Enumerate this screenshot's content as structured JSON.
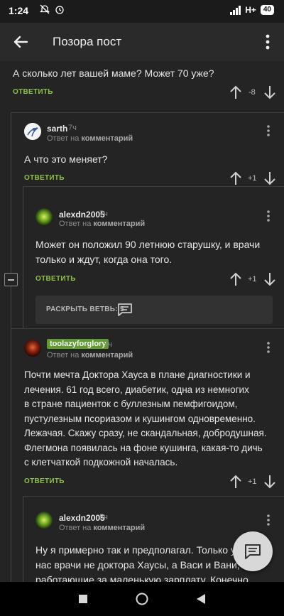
{
  "status_bar": {
    "time": "1:24",
    "icons": [
      "mute-icon",
      "alarm-icon"
    ],
    "network": "H+",
    "battery": "40"
  },
  "app_bar": {
    "title": "Позора пост"
  },
  "comments": [
    {
      "text": "А сколько лет вашей маме? Может 70 уже?",
      "reply_label": "ОТВЕТИТЬ",
      "rating": "-8"
    },
    {
      "username": "sarth",
      "time": "7ч",
      "reply_prefix": "Ответ на",
      "reply_target": "комментарий",
      "text": "А что это меняет?",
      "reply_label": "ОТВЕТИТЬ",
      "rating": "+1"
    },
    {
      "username": "alexdn2005",
      "time": "7ч",
      "reply_prefix": "Ответ на",
      "reply_target": "комментарий",
      "text_lines": [
        "Может он положил 90 летнюю старушку, и врачи",
        "только и ждут, когда она того."
      ],
      "reply_label": "ОТВЕТИТЬ",
      "rating": "+1"
    },
    {
      "username": "toolazyforglory",
      "time": "5ч",
      "reply_prefix": "Ответ на",
      "reply_target": "комментарий",
      "text_lines": [
        "Почти мечта Доктора Хауса в плане диагностики и",
        "лечения. 61 год всего, диабетик, одна из немногих",
        "в стране пациенток с буллезным пемфигоидом,",
        "пустулезным псориазом и кушингом одновременно.",
        "Лежачая. Скажу сразу, не скандальная, добродушная.",
        "Флегмона появилась на фоне кушинга, какая-то дичь",
        "с клетчаткой подкожной началась."
      ],
      "reply_label": "ОТВЕТИТЬ",
      "rating": "+1"
    },
    {
      "username": "alexdn2005",
      "time": "5ч",
      "reply_prefix": "Ответ на",
      "reply_target": "комментарий",
      "text_lines": [
        "Ну я примерно так и предполагал. Только у",
        "нас врачи не доктора Хаусы, а Васи и Вани,",
        "работающие за маленькую зарплату. Конечно"
      ]
    }
  ],
  "expand_branch": {
    "label": "РАСКРЫТЬ ВЕТВЬ: 5"
  },
  "colors": {
    "accent": "#8bc34a",
    "tag": "#5e9c2e",
    "background": "#242424"
  }
}
